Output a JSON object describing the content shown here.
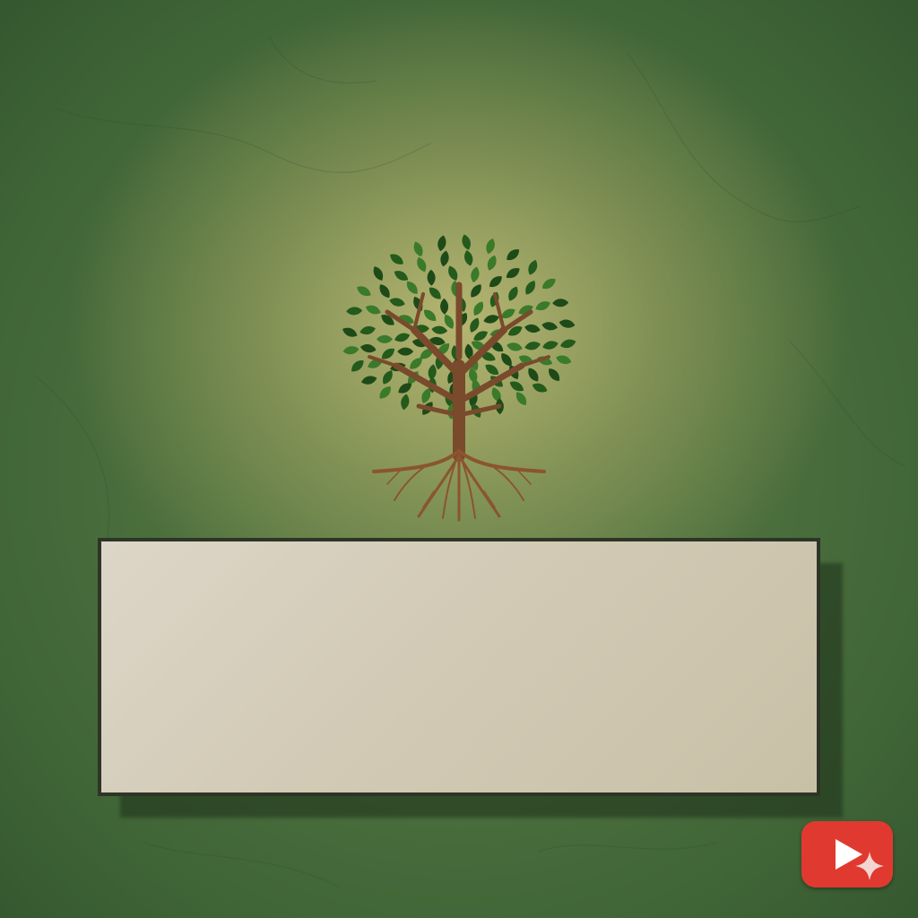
{
  "banner": {
    "text": ""
  },
  "icons": {
    "tree": "tree-with-roots-icon",
    "play": "play-icon",
    "sparkle": "sparkle-icon"
  },
  "colors": {
    "background": "#4e6a3c",
    "glow": "#c4be78",
    "trunk": "#7a4a2c",
    "leaf_dark": "#245a1c",
    "leaf_mid": "#3a7a2a",
    "banner_fill": "#d4ccb8",
    "banner_border": "#2d3526",
    "play_button": "#e03a30"
  }
}
